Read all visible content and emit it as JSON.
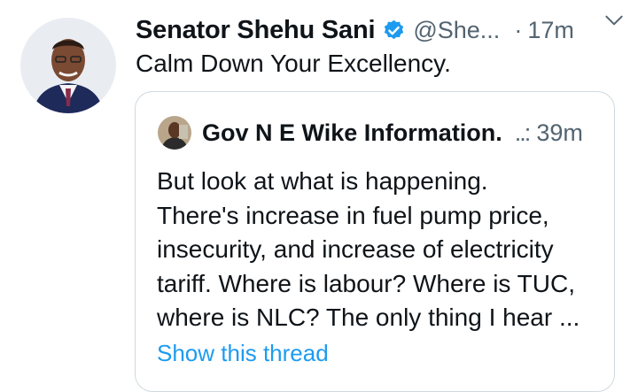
{
  "tweet": {
    "author_name": "Senator Shehu Sani",
    "handle": "@She...",
    "separator": "·",
    "time": "17m",
    "text": "Calm Down Your Excellency.",
    "verified_icon": "verified-badge-icon",
    "menu_icon": "chevron-down-icon"
  },
  "quoted_tweet": {
    "author_name": "Gov N E Wike Information.",
    "dots": "..:",
    "time": "39m",
    "lines": [
      "But look at what is happening.",
      "There's increase in fuel pump price,",
      "insecurity, and increase of electricity",
      "tariff. Where is labour? Where is TUC,",
      "where is NLC? The only thing I hear ..."
    ],
    "show_thread": "Show this thread"
  },
  "colors": {
    "text": "#0f1419",
    "muted": "#536471",
    "link": "#1d9bf0",
    "border": "#cfd9de"
  }
}
